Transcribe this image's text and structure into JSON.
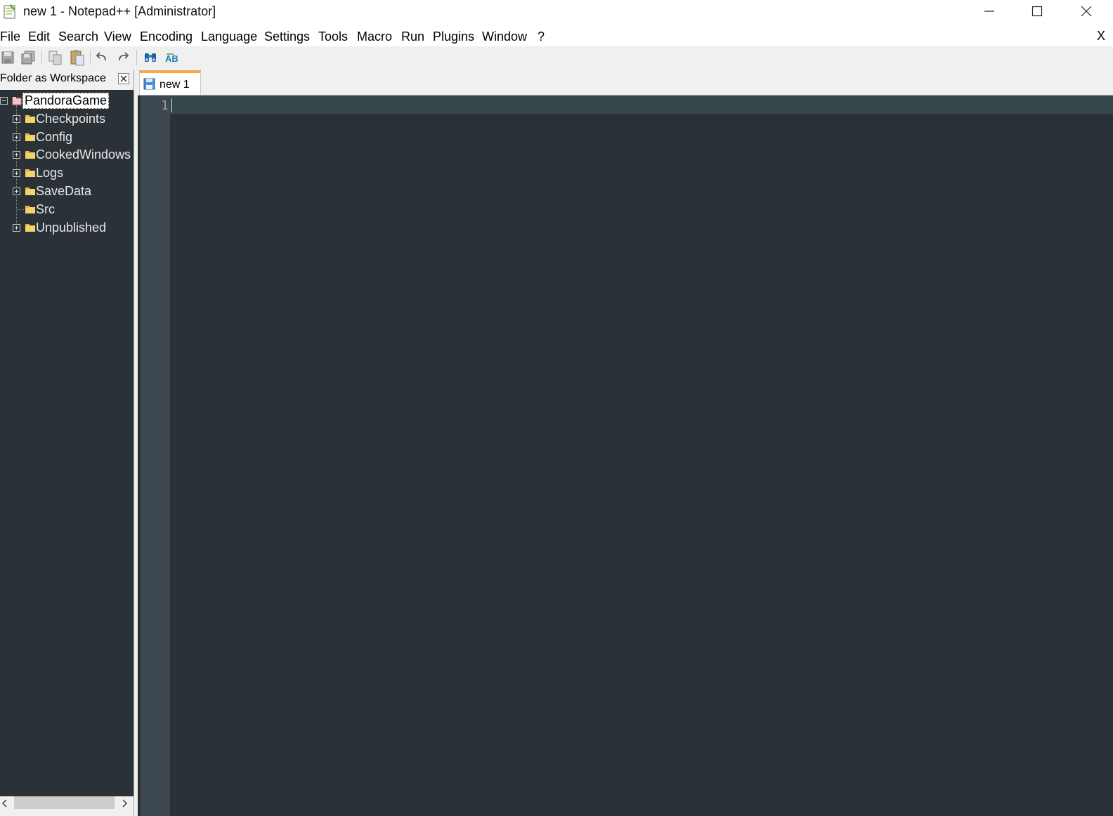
{
  "window": {
    "title": "new 1 - Notepad++ [Administrator]"
  },
  "menu": {
    "items": [
      "File",
      "Edit",
      "Search",
      "View",
      "Encoding",
      "Language",
      "Settings",
      "Tools",
      "Macro",
      "Run",
      "Plugins",
      "Window",
      "?"
    ],
    "close_glyph": "X"
  },
  "panel": {
    "title": "Folder as Workspace",
    "root": "PandoraGame",
    "folders": [
      "Checkpoints",
      "Config",
      "CookedWindows",
      "Logs",
      "SaveData",
      "Src",
      "Unpublished"
    ]
  },
  "tabs": [
    {
      "label": "new 1"
    }
  ],
  "editor": {
    "line_numbers": [
      "1"
    ]
  },
  "colors": {
    "editor_background": "#2a3137",
    "gutter_background": "#3c474f",
    "current_line": "#35494d",
    "active_tab_accent": "#f7a649"
  }
}
